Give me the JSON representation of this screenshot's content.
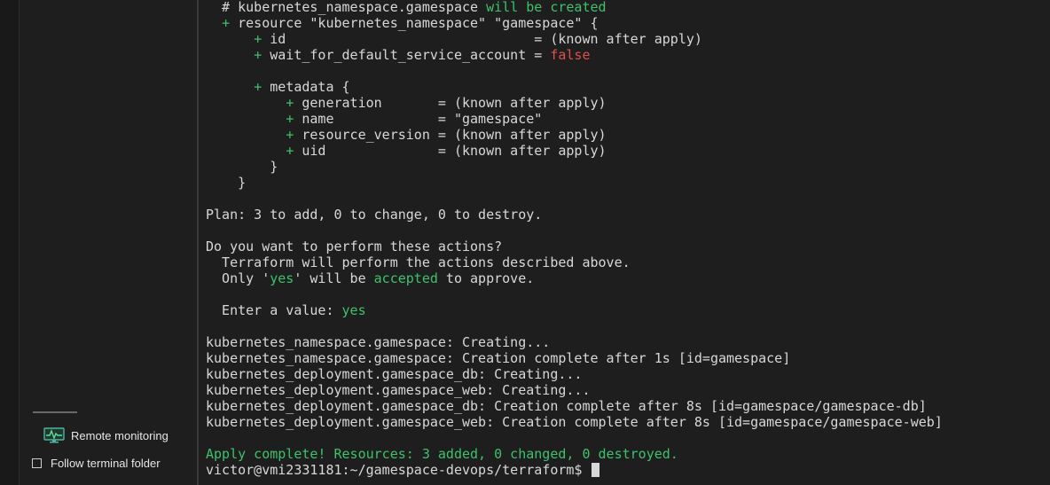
{
  "sidebar": {
    "remote_monitoring_label": "Remote monitoring",
    "follow_terminal_label": "Follow terminal folder",
    "follow_terminal_checked": false
  },
  "terminal": {
    "lines": [
      [
        {
          "t": "  # kubernetes_namespace.gamespace ",
          "c": "plain"
        },
        {
          "t": "will be created",
          "c": "green"
        }
      ],
      [
        {
          "t": "  ",
          "c": "plain"
        },
        {
          "t": "+",
          "c": "green"
        },
        {
          "t": " resource \"kubernetes_namespace\" \"gamespace\" {",
          "c": "plain"
        }
      ],
      [
        {
          "t": "      ",
          "c": "plain"
        },
        {
          "t": "+",
          "c": "green"
        },
        {
          "t": " id                               = (known after apply)",
          "c": "plain"
        }
      ],
      [
        {
          "t": "      ",
          "c": "plain"
        },
        {
          "t": "+",
          "c": "green"
        },
        {
          "t": " wait_for_default_service_account = ",
          "c": "plain"
        },
        {
          "t": "false",
          "c": "red"
        }
      ],
      [
        {
          "t": "",
          "c": "plain"
        }
      ],
      [
        {
          "t": "      ",
          "c": "plain"
        },
        {
          "t": "+",
          "c": "green"
        },
        {
          "t": " metadata {",
          "c": "plain"
        }
      ],
      [
        {
          "t": "          ",
          "c": "plain"
        },
        {
          "t": "+",
          "c": "green"
        },
        {
          "t": " generation       = (known after apply)",
          "c": "plain"
        }
      ],
      [
        {
          "t": "          ",
          "c": "plain"
        },
        {
          "t": "+",
          "c": "green"
        },
        {
          "t": " name             = \"gamespace\"",
          "c": "plain"
        }
      ],
      [
        {
          "t": "          ",
          "c": "plain"
        },
        {
          "t": "+",
          "c": "green"
        },
        {
          "t": " resource_version = (known after apply)",
          "c": "plain"
        }
      ],
      [
        {
          "t": "          ",
          "c": "plain"
        },
        {
          "t": "+",
          "c": "green"
        },
        {
          "t": " uid              = (known after apply)",
          "c": "plain"
        }
      ],
      [
        {
          "t": "        }",
          "c": "plain"
        }
      ],
      [
        {
          "t": "    }",
          "c": "plain"
        }
      ],
      [
        {
          "t": "",
          "c": "plain"
        }
      ],
      [
        {
          "t": "Plan: 3 to add, 0 to change, 0 to destroy.",
          "c": "plain"
        }
      ],
      [
        {
          "t": "",
          "c": "plain"
        }
      ],
      [
        {
          "t": "Do you want to perform these actions?",
          "c": "plain"
        }
      ],
      [
        {
          "t": "  Terraform will perform the actions described above.",
          "c": "plain"
        }
      ],
      [
        {
          "t": "  Only '",
          "c": "plain"
        },
        {
          "t": "yes",
          "c": "green"
        },
        {
          "t": "' will be ",
          "c": "plain"
        },
        {
          "t": "accepted",
          "c": "green"
        },
        {
          "t": " to approve.",
          "c": "plain"
        }
      ],
      [
        {
          "t": "",
          "c": "plain"
        }
      ],
      [
        {
          "t": "  Enter a value: ",
          "c": "plain"
        },
        {
          "t": "yes",
          "c": "green"
        }
      ],
      [
        {
          "t": "",
          "c": "plain"
        }
      ],
      [
        {
          "t": "kubernetes_namespace.gamespace: Creating...",
          "c": "plain"
        }
      ],
      [
        {
          "t": "kubernetes_namespace.gamespace: Creation complete after 1s [id=gamespace]",
          "c": "plain"
        }
      ],
      [
        {
          "t": "kubernetes_deployment.gamespace_db: Creating...",
          "c": "plain"
        }
      ],
      [
        {
          "t": "kubernetes_deployment.gamespace_web: Creating...",
          "c": "plain"
        }
      ],
      [
        {
          "t": "kubernetes_deployment.gamespace_db: Creation complete after 8s [id=gamespace/gamespace-db]",
          "c": "plain"
        }
      ],
      [
        {
          "t": "kubernetes_deployment.gamespace_web: Creation complete after 8s [id=gamespace/gamespace-web]",
          "c": "plain"
        }
      ],
      [
        {
          "t": "",
          "c": "plain"
        }
      ],
      [
        {
          "t": "Apply complete! Resources: 3 added, 0 changed, 0 destroyed.",
          "c": "green"
        }
      ]
    ],
    "prompt": "victor@vmi2331181:~/gamespace-devops/terraform$ "
  }
}
